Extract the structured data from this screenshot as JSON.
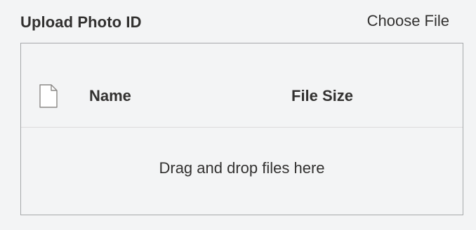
{
  "upload": {
    "title": "Upload Photo ID",
    "choose_file_label": "Choose File",
    "columns": {
      "icon": "file-icon",
      "name": "Name",
      "size": "File Size"
    },
    "drop_hint": "Drag and drop files here"
  },
  "colors": {
    "background": "#f3f4f5",
    "border": "#a6a8aa",
    "divider": "#dcdcdc",
    "text": "#323130"
  }
}
